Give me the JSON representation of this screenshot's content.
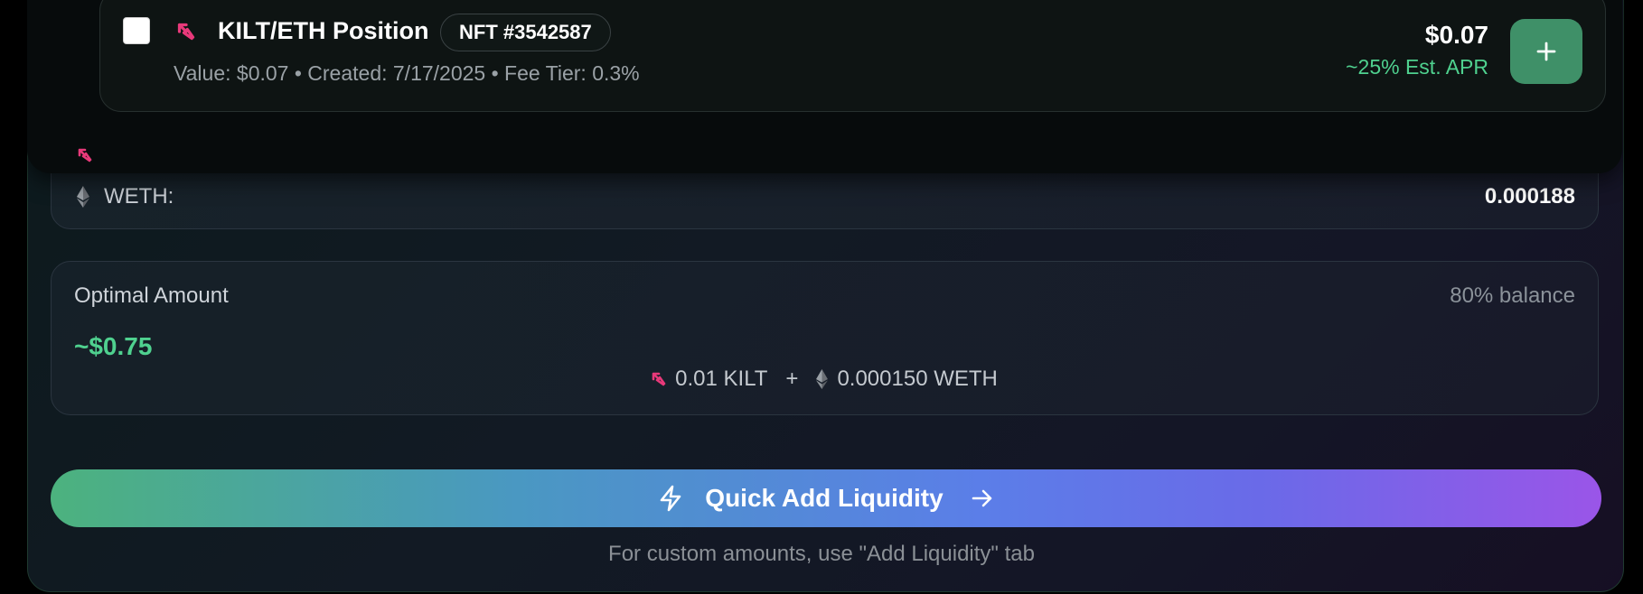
{
  "position_card": {
    "title": "KILT/ETH Position",
    "nft_badge": "NFT #3542587",
    "meta": "Value: $0.07 • Created: 7/17/2025 • Fee Tier: 0.3%",
    "value": "$0.07",
    "apr": "~25% Est. APR",
    "add_icon": "plus-icon",
    "checked": false
  },
  "balances": {
    "weth_label": "WETH:",
    "weth_value": "0.000188"
  },
  "optimal": {
    "title": "Optimal Amount",
    "balance_note": "80% balance",
    "usd": "~$0.75",
    "kilt_amount": "0.01 KILT",
    "plus": "+",
    "weth_amount": "0.000150 WETH"
  },
  "quick_add": {
    "label": "Quick Add Liquidity",
    "icon_left": "lightning-icon",
    "icon_right": "arrow-right-icon"
  },
  "hint": "For custom amounts, use \"Add Liquidity\" tab",
  "colors": {
    "accent_green": "#4fd18f",
    "kilt_pink": "#e8397a",
    "button_green": "#3f9068",
    "gradient_start": "#4cb27e",
    "gradient_end": "#9a55e8"
  }
}
